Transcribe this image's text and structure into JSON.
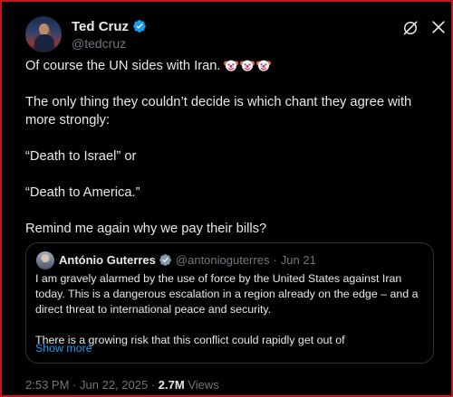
{
  "author": {
    "name": "Ted Cruz",
    "handle": "@tedcruz"
  },
  "tweet": {
    "line1": "Of course the UN sides with Iran.",
    "emoji": [
      "clown-face",
      "clown-face",
      "clown-face"
    ],
    "line2": "The only thing they couldn’t decide is which chant they agree with more strongly:",
    "line3": "“Death to Israel” or",
    "line4": "“Death to America.”",
    "line5": "Remind me again why we pay their bills?"
  },
  "quoted": {
    "name": "António Guterres",
    "handle": "@antonioguterres",
    "separator": "·",
    "date": "Jun 21",
    "paragraph1": "I am gravely alarmed by the use of force by the United States against Iran today. This is a dangerous escalation in a region already on the edge – and a direct threat to international peace and security.",
    "paragraph2": "There is a growing risk that this conflict could rapidly get out of",
    "show_more": "Show more"
  },
  "meta": {
    "time": "2:53 PM",
    "separator": "·",
    "date": "Jun 22, 2025",
    "views_count": "2.7M",
    "views_label": "Views"
  },
  "colors": {
    "verified_badge": "#1d9bf0",
    "link": "#1d9bf0",
    "muted_text": "#71767b",
    "frame_border": "#c0171d"
  }
}
